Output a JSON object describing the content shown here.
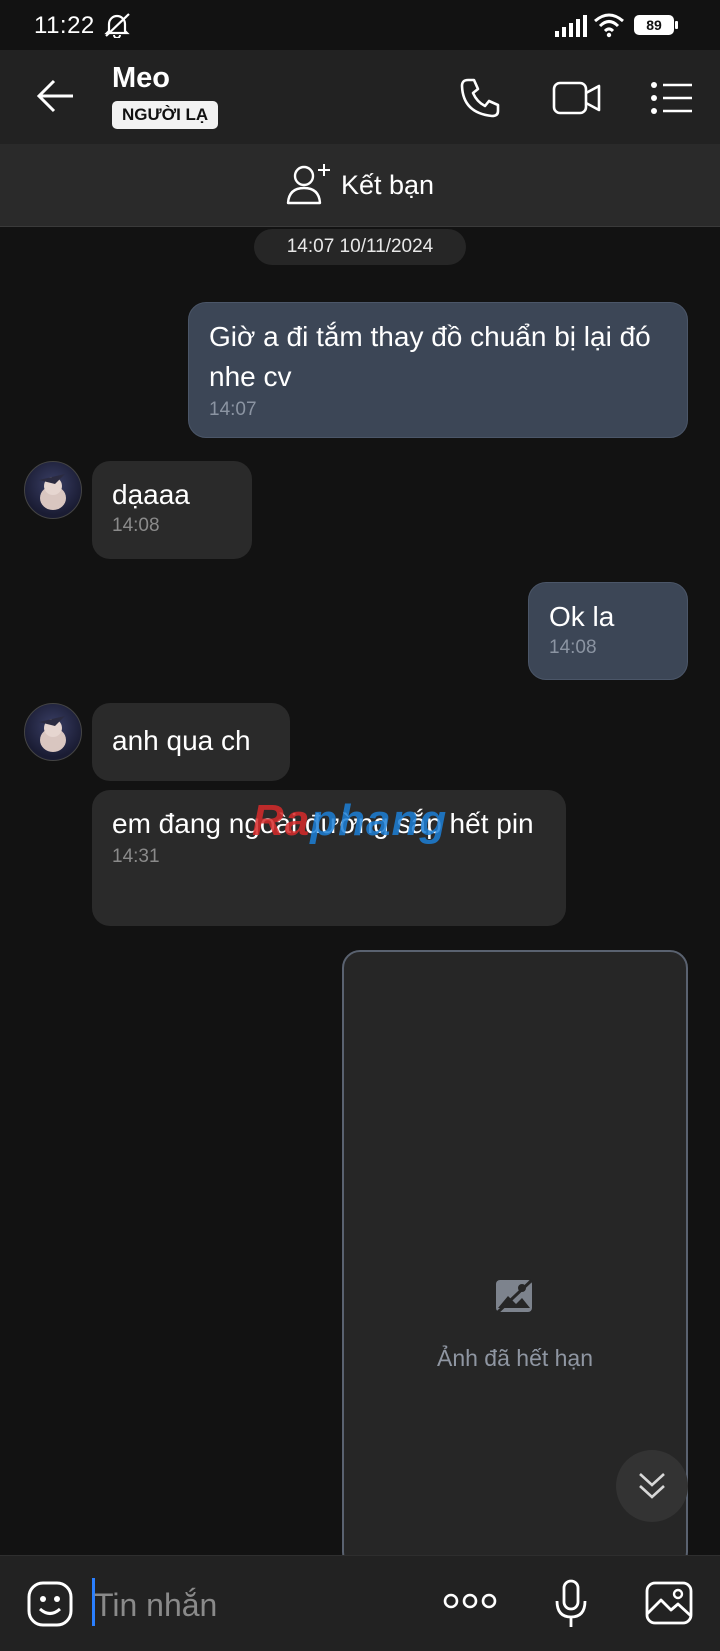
{
  "status_bar": {
    "time": "11:22",
    "battery": "89"
  },
  "header": {
    "contact_name": "Meo",
    "stranger_badge": "NGƯỜI LẠ",
    "back_icon": "arrow-left-icon",
    "call_icon": "phone-icon",
    "video_icon": "video-icon",
    "menu_icon": "list-menu-icon"
  },
  "friend_bar": {
    "label": "Kết bạn",
    "icon": "add-user-icon"
  },
  "chat": {
    "date_chip": "14:07 10/11/2024",
    "messages": [
      {
        "direction": "out",
        "text": "Giờ a đi tắm thay đồ chuẩn bị lại đó nhe cv",
        "time": "14:07"
      },
      {
        "direction": "in",
        "text": "dạaaa",
        "time": "14:08"
      },
      {
        "direction": "out",
        "text": "Ok la",
        "time": "14:08"
      },
      {
        "direction": "in",
        "text": "anh qua ch",
        "time": ""
      },
      {
        "direction": "in",
        "text": "em đang ngoài đường sắp hết pin",
        "time": "14:31"
      }
    ],
    "expired_image_label": "Ảnh đã hết hạn"
  },
  "watermark": {
    "part1": "Ra",
    "part2": "phang"
  },
  "input_bar": {
    "placeholder": "Tin nhắn"
  },
  "colors": {
    "accent": "#2a7fff",
    "out_bubble": "#3c4656",
    "in_bubble": "#2a2a2a",
    "background": "#121212"
  }
}
